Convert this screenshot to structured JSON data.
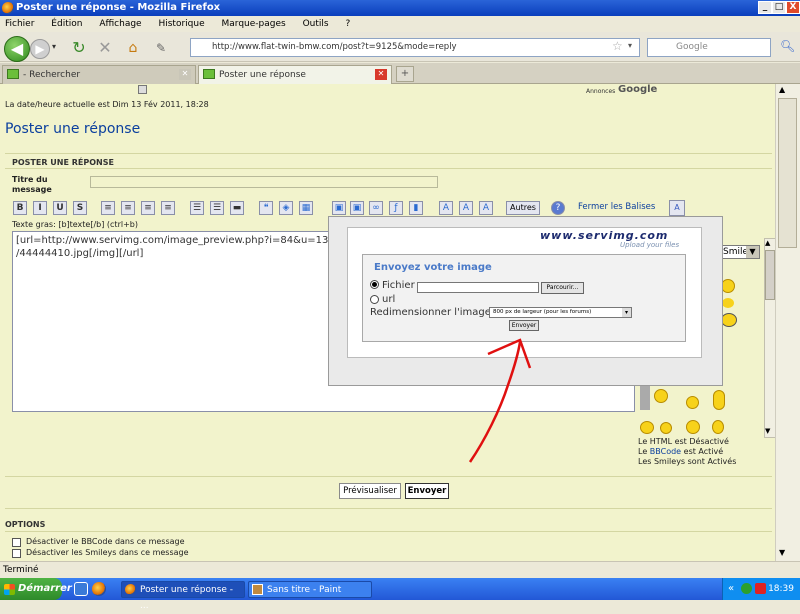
{
  "window": {
    "title": "Poster une réponse - Mozilla Firefox",
    "min": "_",
    "max": "□",
    "close": "X"
  },
  "menu": [
    "Fichier",
    "Édition",
    "Affichage",
    "Historique",
    "Marque-pages",
    "Outils",
    "?"
  ],
  "nav": {
    "url": "http://www.flat-twin-bmw.com/post?t=9125&mode=reply",
    "search_placeholder": "Google"
  },
  "tabs": [
    {
      "label": "- Rechercher"
    },
    {
      "label": "Poster une réponse"
    }
  ],
  "page": {
    "ads_label": "Annonces",
    "ads_brand": "Google",
    "date_line": "La date/heure actuelle est Dim 13 Fév 2011, 18:28",
    "heading": "Poster une réponse",
    "section_title": "POSTER UNE RÉPONSE",
    "subject_label_1": "Titre du",
    "subject_label_2": "message",
    "toolbar_others": "Autres",
    "toolbar_help": "?",
    "close_tags": "Fermer les Balises",
    "hint": "Texte gras: [b]texte[/b] (ctrl+b)",
    "message_line1": "[url=http://www.servimg.com/image_preview.php?i=84&u=13",
    "message_line2": "/44444410.jpg[/img][/url]",
    "smileys_label": "Smileys",
    "html_status": "Le HTML est Désactivé",
    "bbcode_prefix": "Le ",
    "bbcode_link": "BBCode",
    "bbcode_suffix": " est Activé",
    "smileys_status": "Les Smileys sont Activés",
    "preview_button": "Prévisualiser",
    "send_button": "Envoyer",
    "options_title": "OPTIONS",
    "option1": "Désactiver le BBCode dans ce message",
    "option2": "Désactiver les Smileys dans ce message"
  },
  "popup": {
    "logo": "www.servimg.com",
    "tagline": "Upload your files",
    "title": "Envoyez votre image",
    "radio_file": "Fichier",
    "browse": "Parcourir...",
    "radio_url": "url",
    "resize_label": "Redimensionner l'image",
    "resize_value": "800 px de largeur (pour les forums)",
    "submit": "Envoyer"
  },
  "status": {
    "text": "Terminé"
  },
  "taskbar": {
    "start": "Démarrer",
    "tasks": [
      "Poster une réponse - ...",
      "Sans titre - Paint"
    ],
    "clock": "18:39",
    "tray_chevron": "«"
  },
  "colors": {
    "accent": "#0b3f9e",
    "page_bg": "#f2f3cc",
    "annotation": "#e01010"
  }
}
